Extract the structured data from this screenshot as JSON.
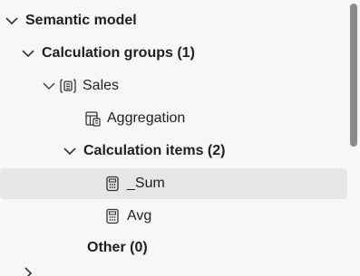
{
  "tree": {
    "semantic_model_label": "Semantic model",
    "calc_groups_label": "Calculation groups (1)",
    "sales_label": "Sales",
    "aggregation_label": "Aggregation",
    "calc_items_label": "Calculation items (2)",
    "sum_label": "_Sum",
    "avg_label": "Avg",
    "other_label": "Other (0)"
  },
  "icons": {
    "table": "calculation-group-table-icon",
    "column": "calculation-column-icon",
    "item": "calculator-icon"
  },
  "colors": {
    "selected_bg": "#e6e6e6",
    "scrollbar_thumb": "#8a8a8a"
  }
}
